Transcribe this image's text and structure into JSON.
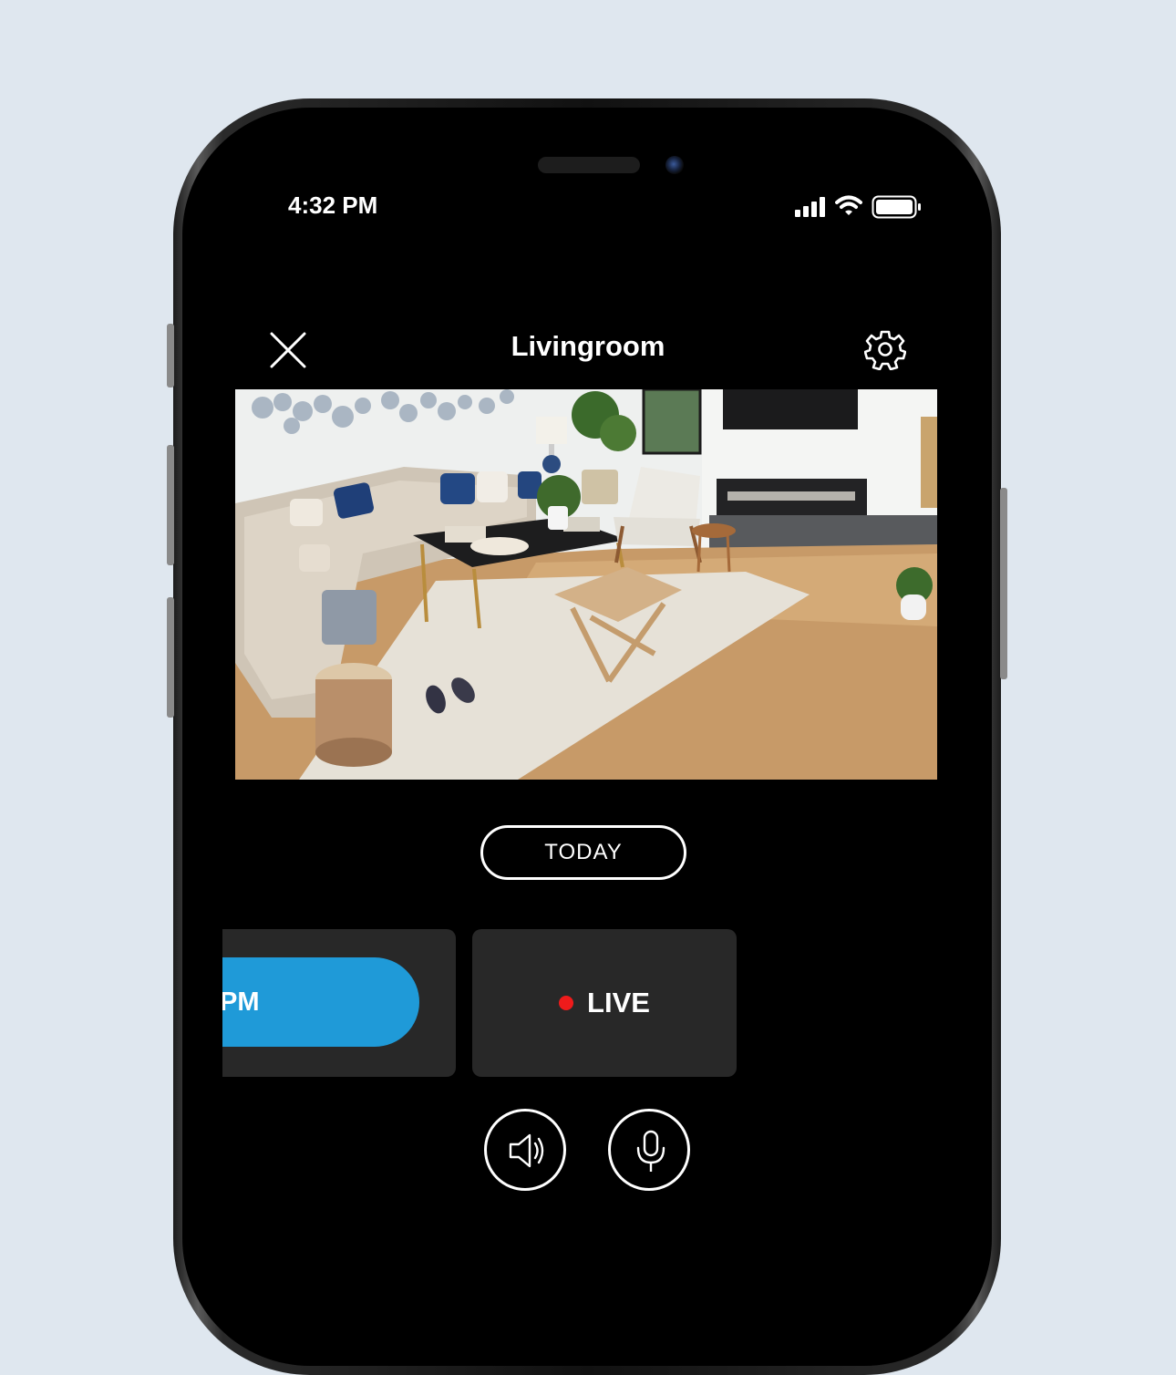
{
  "status_bar": {
    "time": "4:32 PM",
    "icons": [
      "signal-icon",
      "wifi-icon",
      "battery-icon"
    ]
  },
  "header": {
    "title": "Livingroom",
    "close_icon": "close-icon",
    "settings_icon": "gear-icon"
  },
  "video": {
    "content": "living-room-camera-feed"
  },
  "timeline": {
    "today_label": "TODAY",
    "clip_time_label": "PM",
    "live_label": "LIVE"
  },
  "controls": {
    "speaker_icon": "speaker-icon",
    "mic_icon": "microphone-icon"
  },
  "colors": {
    "accent": "#1f9ad8",
    "live_dot": "#ef1b1b",
    "card_bg": "#282828",
    "page_bg": "#dfe7ef"
  }
}
